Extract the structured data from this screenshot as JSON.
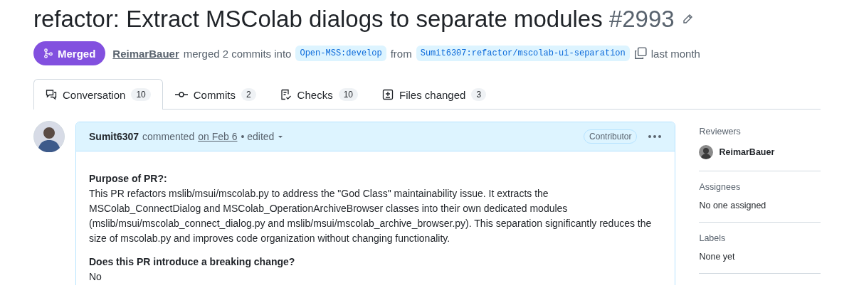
{
  "title": "refactor: Extract MSColab dialogs to separate modules",
  "number": "#2993",
  "status": {
    "label": "Merged"
  },
  "summary": {
    "author": "ReimarBauer",
    "action": "merged 2 commits into",
    "base": "Open-MSS:develop",
    "from": "from",
    "head": "Sumit6307:refactor/mscolab-ui-separation",
    "time": "last month"
  },
  "tabs": [
    {
      "label": "Conversation",
      "count": "10",
      "selected": true
    },
    {
      "label": "Commits",
      "count": "2",
      "selected": false
    },
    {
      "label": "Checks",
      "count": "10",
      "selected": false
    },
    {
      "label": "Files changed",
      "count": "3",
      "selected": false
    }
  ],
  "comment": {
    "author": "Sumit6307",
    "action": "commented",
    "date": "on Feb 6",
    "edited": "• edited",
    "badge": "Contributor",
    "body": [
      {
        "kind": "heading",
        "text": "Purpose of PR?:"
      },
      {
        "kind": "paragraph",
        "text": "This PR refactors mslib/msui/mscolab.py to address the \"God Class\" maintainability issue. It extracts the MSColab_ConnectDialog and MSColab_OperationArchiveBrowser classes into their own dedicated modules (mslib/msui/mscolab_connect_dialog.py and mslib/msui/mscolab_archive_browser.py). This separation significantly reduces the size of mscolab.py and improves code organization without changing functionality."
      },
      {
        "kind": "heading",
        "text": "Does this PR introduce a breaking change?"
      },
      {
        "kind": "paragraph",
        "text": "No"
      }
    ]
  },
  "sidebar": [
    {
      "heading": "Reviewers",
      "value": "ReimarBauer",
      "kind": "person"
    },
    {
      "heading": "Assignees",
      "value": "No one assigned",
      "kind": "text"
    },
    {
      "heading": "Labels",
      "value": "None yet",
      "kind": "text"
    }
  ]
}
